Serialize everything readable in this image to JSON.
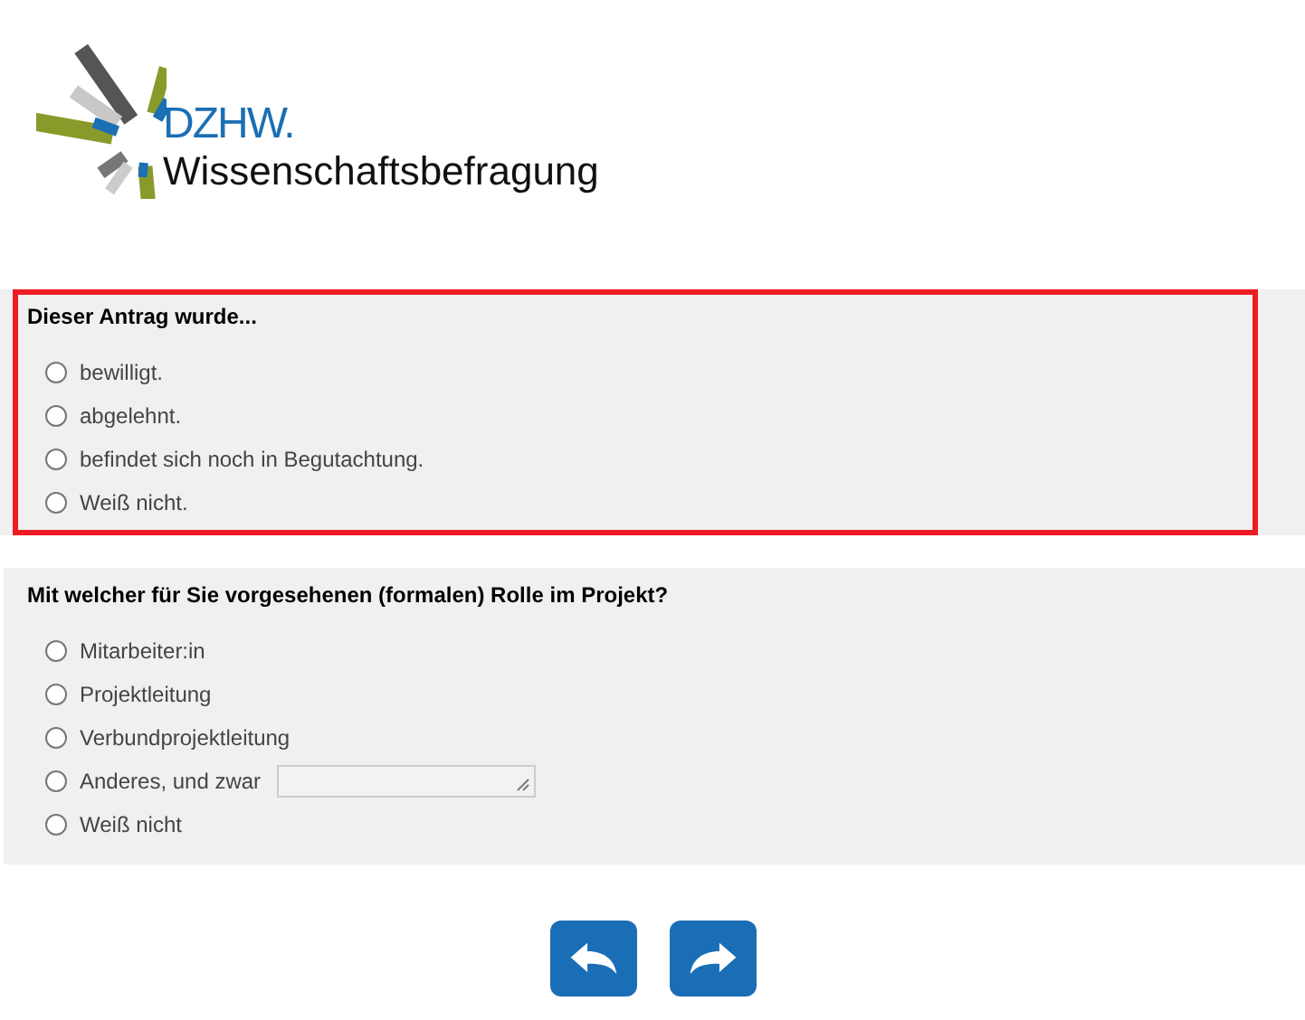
{
  "logo": {
    "brand": "DZHW.",
    "subtitle": "Wissenschaftsbefragung"
  },
  "questions": [
    {
      "title": "Dieser Antrag wurde...",
      "error": true,
      "options": [
        {
          "kind": "radio",
          "label": "bewilligt.",
          "selected": false
        },
        {
          "kind": "radio",
          "label": "abgelehnt.",
          "selected": false
        },
        {
          "kind": "radio",
          "label": "befindet sich noch in Begutachtung.",
          "selected": false
        },
        {
          "kind": "radio",
          "label": "Weiß nicht.",
          "selected": false
        }
      ]
    },
    {
      "title": "Mit welcher für Sie vorgesehenen (formalen) Rolle im Projekt?",
      "error": false,
      "options": [
        {
          "kind": "radio",
          "label": "Mitarbeiter:in",
          "selected": false
        },
        {
          "kind": "radio",
          "label": "Projektleitung",
          "selected": false
        },
        {
          "kind": "radio",
          "label": "Verbundprojektleitung",
          "selected": false
        },
        {
          "kind": "text_input",
          "label": "Anderes, und zwar",
          "selected": false
        },
        {
          "kind": "radio",
          "label": "Weiß nicht",
          "selected": false
        }
      ]
    }
  ],
  "navigation": [
    {
      "kind": "back"
    },
    {
      "kind": "next"
    }
  ]
}
